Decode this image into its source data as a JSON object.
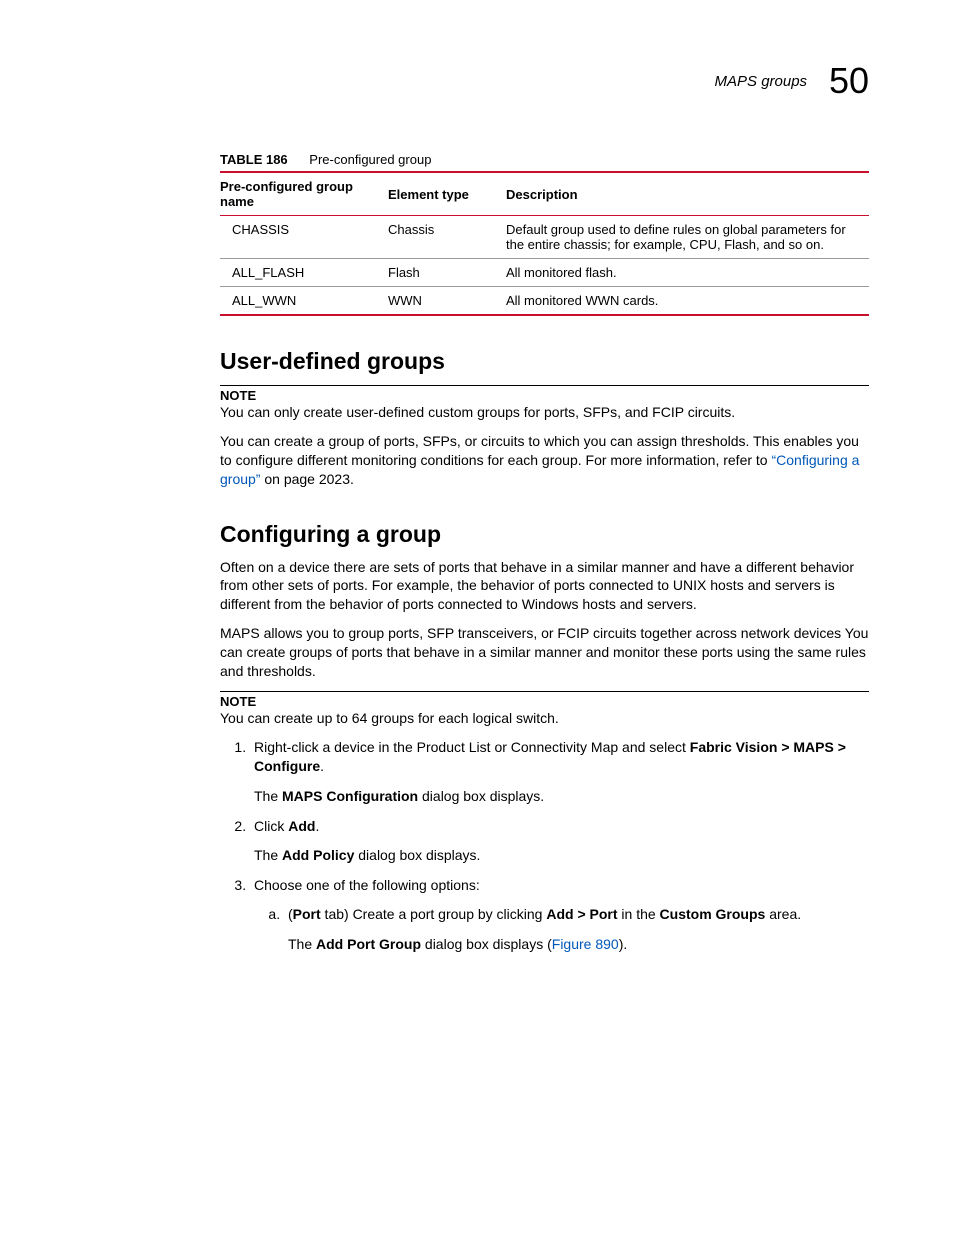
{
  "header": {
    "section": "MAPS groups",
    "chapter": "50"
  },
  "table": {
    "number": "TABLE 186",
    "title": "Pre-configured group",
    "cols": [
      "Pre-configured group name",
      "Element type",
      "Description"
    ],
    "rows": [
      {
        "name": "CHASSIS",
        "type": "Chassis",
        "desc": "Default group used to define rules on global parameters for the entire chassis; for example, CPU, Flash, and so on."
      },
      {
        "name": "ALL_FLASH",
        "type": "Flash",
        "desc": "All monitored flash."
      },
      {
        "name": "ALL_WWN",
        "type": "WWN",
        "desc": "All monitored WWN cards."
      }
    ]
  },
  "sec1": {
    "title": "User-defined groups",
    "note_label": "NOTE",
    "note_text": "You can only create user-defined custom groups for ports, SFPs, and FCIP circuits.",
    "para_a": "You can create a group of ports, SFPs, or circuits to which you can assign thresholds. This enables you to configure different monitoring conditions for each group. For more information, refer to ",
    "link": "“Configuring a group”",
    "para_b": " on page 2023."
  },
  "sec2": {
    "title": "Configuring a group",
    "p1": "Often on a device there are sets of ports that behave in a similar manner and have a different behavior from other sets of ports. For example, the behavior of ports connected to UNIX hosts and servers is different from the behavior of ports connected to Windows hosts and servers.",
    "p2": "MAPS allows you to group ports, SFP transceivers, or FCIP circuits together across network devices You can create groups of ports that behave in a similar manner and monitor these ports using the same rules and thresholds.",
    "note_label": "NOTE",
    "note_text": "You can create up to 64 groups for each logical switch.",
    "steps": {
      "s1a": "Right-click a device in the Product List or Connectivity Map and select ",
      "s1b": "Fabric Vision > MAPS > Configure",
      "s1c": ".",
      "s1sub_a": "The ",
      "s1sub_b": "MAPS Configuration",
      "s1sub_c": " dialog box displays.",
      "s2a": "Click ",
      "s2b": "Add",
      "s2c": ".",
      "s2sub_a": "The ",
      "s2sub_b": "Add Policy",
      "s2sub_c": " dialog box displays.",
      "s3": "Choose one of the following options:",
      "s3a_1": "(",
      "s3a_2": "Port",
      "s3a_3": " tab) Create a port group by clicking ",
      "s3a_4": "Add > Port",
      "s3a_5": " in the ",
      "s3a_6": "Custom Groups",
      "s3a_7": " area.",
      "s3a_sub_a": "The ",
      "s3a_sub_b": "Add Port Group",
      "s3a_sub_c": " dialog box displays (",
      "s3a_sub_link": "Figure 890",
      "s3a_sub_d": ")."
    }
  }
}
